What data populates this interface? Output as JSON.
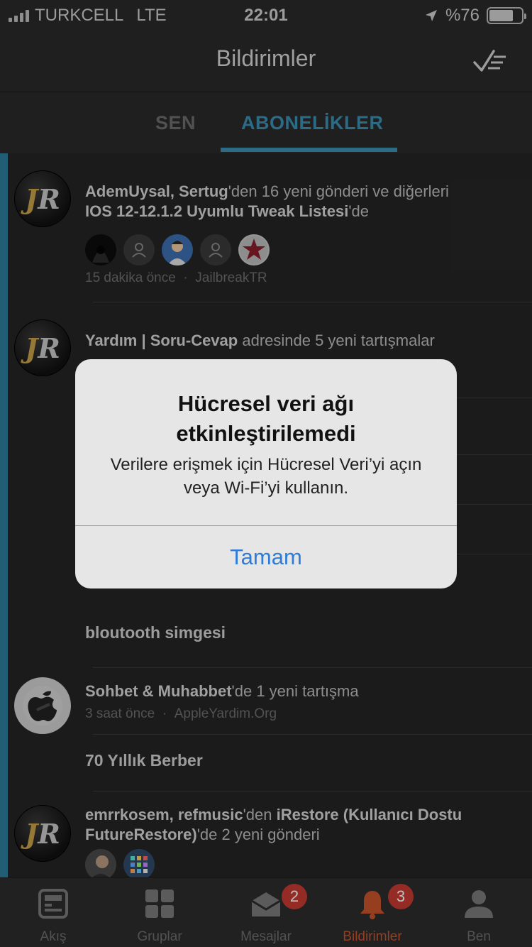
{
  "status_bar": {
    "carrier": "TURKCELL",
    "network": "LTE",
    "time": "22:01",
    "battery_text": "%76",
    "battery_level": 0.76
  },
  "nav": {
    "title": "Bildirimler",
    "mark_all_read_icon": "checkmark-list-icon"
  },
  "tabs": [
    {
      "label": "SEN",
      "active": false
    },
    {
      "label": "ABONELİKLER",
      "active": true
    }
  ],
  "notifications": [
    {
      "avatar": "JR",
      "users": "AdemUysal, Sertug",
      "text1": "'den 16 yeni gönderi ve diğerleri",
      "topic": "IOS 12-12.1.2 Uyumlu Tweak Listesi",
      "text2": "'de",
      "time": "15 dakika önce",
      "source": "JailbreakTR"
    },
    {
      "avatar": "JR",
      "forum": "Yardım | Soru-Cevap",
      "text": " adresinde 5 yeni tartışmalar"
    },
    {
      "title": "bloutooth simgesi"
    },
    {
      "avatar": "apple",
      "forum": "Sohbet & Muhabbet",
      "text": "'de 1 yeni tartışma",
      "time": "3 saat önce",
      "source": "AppleYardim.Org"
    },
    {
      "title": "70 Yıllık Berber"
    },
    {
      "avatar": "JR",
      "users": "emrrkosem, refmusic",
      "text1": "'den ",
      "topic": "iRestore (Kullanıcı Dostu FutureRestore)",
      "text2": "'de 2 yeni gönderi"
    }
  ],
  "meta_separator": "·",
  "alert": {
    "title": "Hücresel veri ağı etkinleştirilemedi",
    "message": "Verilere erişmek için Hücresel Veri’yi açın veya Wi-Fi’yi kullanın.",
    "button": "Tamam"
  },
  "tab_bar": [
    {
      "label": "Akış",
      "icon": "feed-icon"
    },
    {
      "label": "Gruplar",
      "icon": "groups-icon"
    },
    {
      "label": "Mesajlar",
      "icon": "envelope-icon",
      "badge": "2"
    },
    {
      "label": "Bildirimler",
      "icon": "bell-icon",
      "badge": "3",
      "active": true
    },
    {
      "label": "Ben",
      "icon": "person-icon"
    }
  ],
  "colors": {
    "accent": "#3b8fb3",
    "active_tab": "#c9542b",
    "badge": "#c63b32",
    "alert_button": "#2f7bd8"
  }
}
